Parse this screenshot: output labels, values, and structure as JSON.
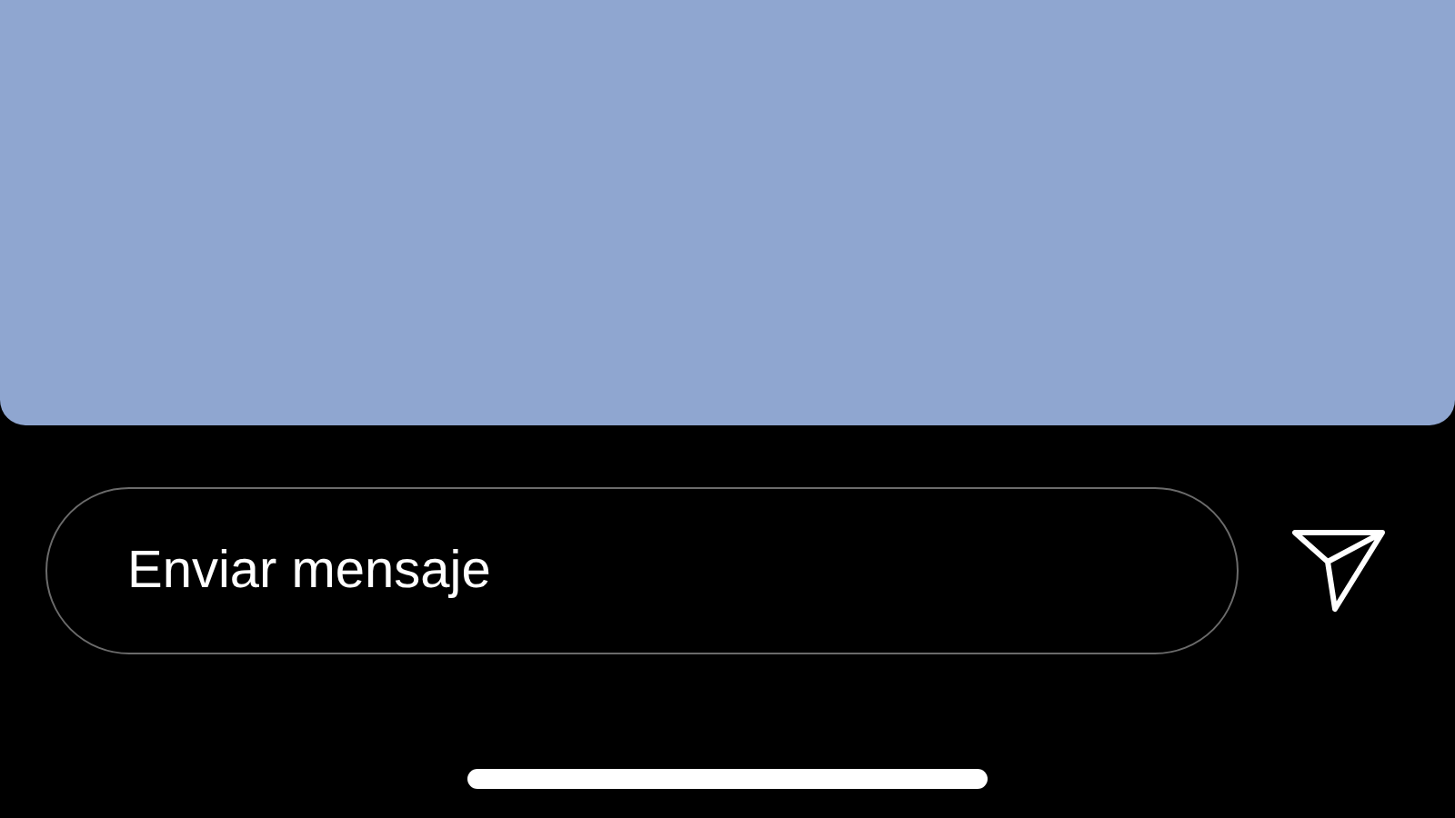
{
  "message_field": {
    "placeholder": "Enviar mensaje"
  }
}
